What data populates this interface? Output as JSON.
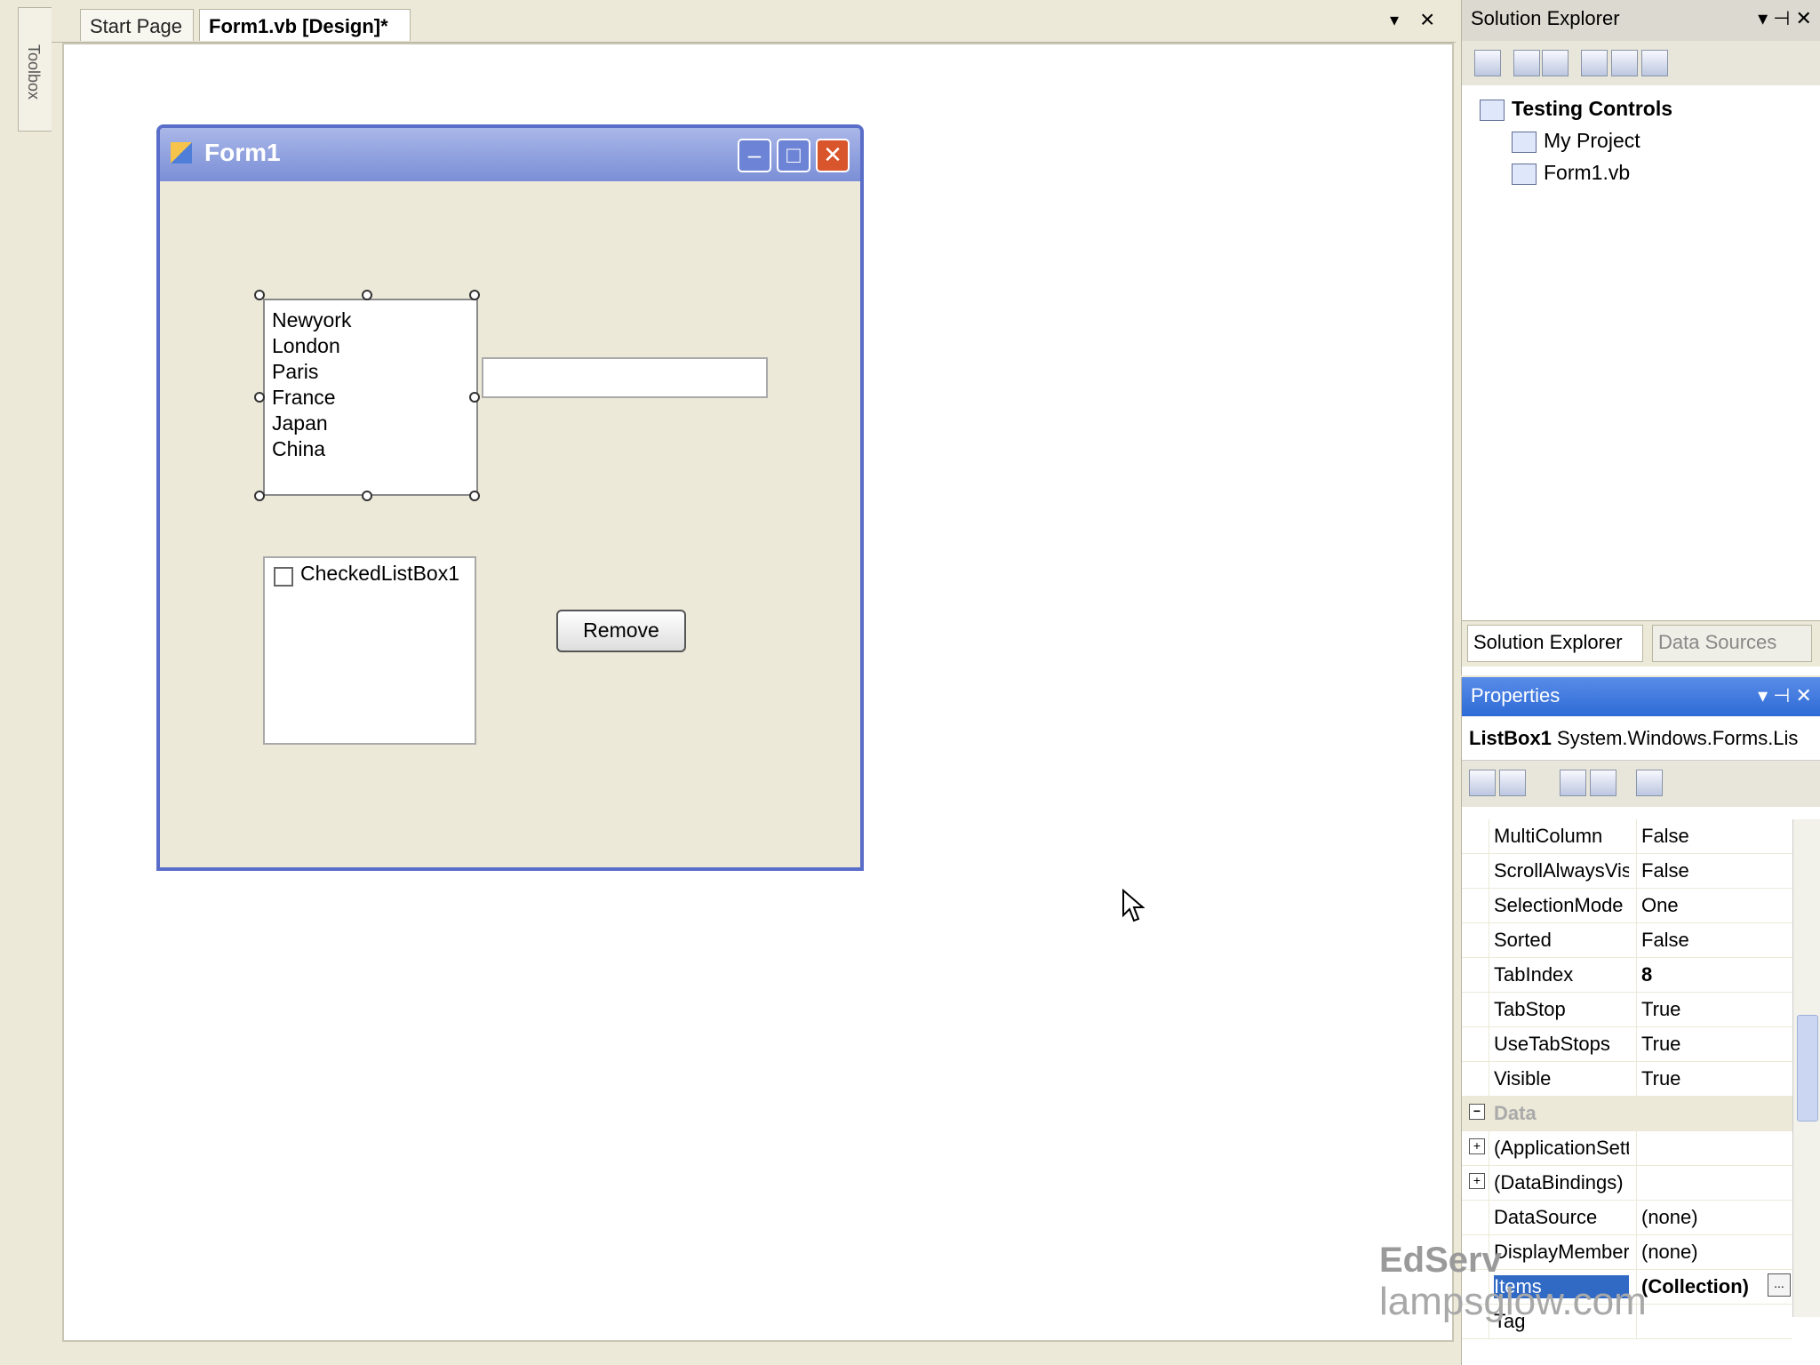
{
  "toolbox": {
    "label": "Toolbox"
  },
  "tabs": {
    "start": "Start Page",
    "form": "Form1.vb [Design]*",
    "dropdown": "▾",
    "close": "×"
  },
  "form": {
    "title": "Form1",
    "listbox_items": [
      "Newyork",
      "London",
      "Paris",
      "France",
      "Japan",
      "China"
    ],
    "textbox_value": "",
    "checkedlist_item": "CheckedListBox1",
    "remove_button": "Remove",
    "window_buttons": {
      "min": "–",
      "max": "□",
      "close": "✕"
    }
  },
  "solution_explorer": {
    "title": "Solution Explorer",
    "header_controls": "▾ ⊣ ✕",
    "tree": {
      "root": "Testing Controls",
      "child1": "My Project",
      "child2": "Form1.vb"
    },
    "tabs": {
      "tab1": "Solution Explorer",
      "tab2": "Data Sources"
    }
  },
  "properties": {
    "title": "Properties",
    "header_controls": "▾ ⊣ ✕",
    "object_name": "ListBox1",
    "object_type": "System.Windows.Forms.Lis",
    "rows": [
      {
        "name": "MultiColumn",
        "value": "False"
      },
      {
        "name": "ScrollAlwaysVisib",
        "value": "False"
      },
      {
        "name": "SelectionMode",
        "value": "One"
      },
      {
        "name": "Sorted",
        "value": "False"
      },
      {
        "name": "TabIndex",
        "value": "8"
      },
      {
        "name": "TabStop",
        "value": "True"
      },
      {
        "name": "UseTabStops",
        "value": "True"
      },
      {
        "name": "Visible",
        "value": "True"
      },
      {
        "name": "Data",
        "value": ""
      },
      {
        "name": "(ApplicationSetti",
        "value": ""
      },
      {
        "name": "(DataBindings)",
        "value": ""
      },
      {
        "name": "DataSource",
        "value": "(none)"
      },
      {
        "name": "DisplayMember",
        "value": "(none)"
      },
      {
        "name": "Items",
        "value": "(Collection)"
      },
      {
        "name": "Tag",
        "value": ""
      }
    ]
  },
  "watermark": {
    "line1": "EdServ",
    "line2": "lampsglow.com"
  }
}
